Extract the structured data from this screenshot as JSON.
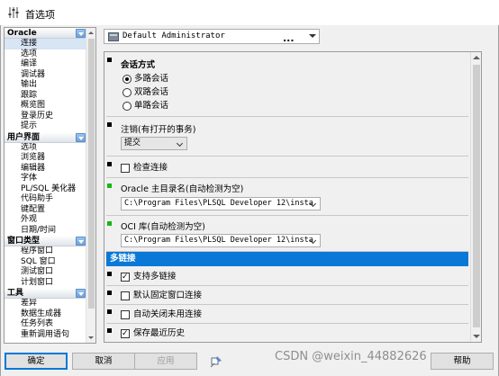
{
  "window": {
    "title": "首选项"
  },
  "profile": {
    "value": "Default Administrator",
    "more_label": "..."
  },
  "tree": {
    "categories": [
      {
        "label": "Oracle",
        "items": [
          "连接",
          "选项",
          "编译",
          "调试器",
          "输出",
          "跟踪",
          "概览图",
          "登录历史",
          "提示"
        ]
      },
      {
        "label": "用户界面",
        "items": [
          "选项",
          "浏览器",
          "编辑器",
          "字体",
          "PL/SQL 美化器",
          "代码助手",
          "键配置",
          "外观",
          "日期/时间"
        ]
      },
      {
        "label": "窗口类型",
        "items": [
          "程序窗口",
          "SQL 窗口",
          "测试窗口",
          "计划窗口"
        ]
      },
      {
        "label": "工具",
        "items": [
          "差异",
          "数据生成器",
          "任务列表",
          "重新调用语句"
        ]
      }
    ],
    "selected": "连接"
  },
  "panel": {
    "session": {
      "title": "会话方式",
      "options": [
        "多路会话",
        "双路会话",
        "单路会话"
      ],
      "selected_index": 0
    },
    "logoff": {
      "label": "注销(有打开的事务)",
      "value": "提交"
    },
    "check_connection": {
      "label": "检查连接",
      "checked": false
    },
    "oracle_home": {
      "label": "Oracle 主目录名(自动检测为空)",
      "value": "C:\\Program Files\\PLSQL Developer 12\\insta"
    },
    "oci_lib": {
      "label": "OCI 库(自动检测为空)",
      "value": "C:\\Program Files\\PLSQL Developer 12\\insta"
    },
    "multi_header": "多链接",
    "multi": [
      {
        "label": "支持多链接",
        "checked": true
      },
      {
        "label": "默认固定窗口连接",
        "checked": false
      },
      {
        "label": "自动关闭未用连接",
        "checked": false
      },
      {
        "label": "保存最近历史",
        "checked": true
      }
    ]
  },
  "buttons": {
    "ok": "确定",
    "cancel": "取消",
    "apply": "应用",
    "help": "帮助"
  },
  "watermark": "CSDN @weixin_44882626",
  "colors": {
    "accent": "#0a78d7",
    "selected_bg": "#d7e5f5",
    "mark_green": "#14b814"
  }
}
